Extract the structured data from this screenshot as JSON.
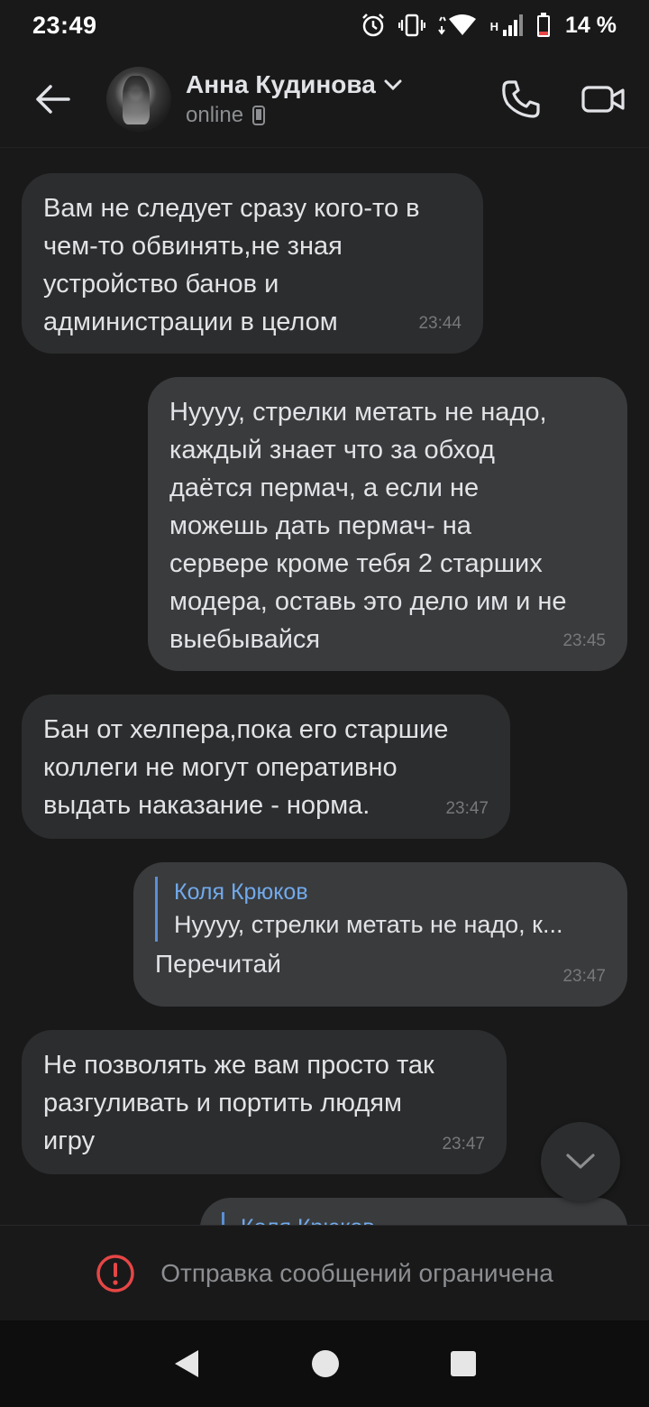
{
  "status_bar": {
    "time": "23:49",
    "network_label": "H",
    "battery": "14 %"
  },
  "header": {
    "contact_name": "Анна Кудинова",
    "contact_status": "online"
  },
  "messages": [
    {
      "direction": "in",
      "text": "Вам не следует сразу кого-то в\nчем-то обвинять,не зная\nустройство банов и\nадминистрации в целом",
      "time": "23:44"
    },
    {
      "direction": "out",
      "text": "Нуууу, стрелки метать не надо,\nкаждый знает что за обход\nдаётся пермач, а если не\nможешь дать пермач- на\nсервере кроме тебя 2 старших\nмодера, оставь это дело им и не\nвыебывайся",
      "time": "23:45"
    },
    {
      "direction": "in",
      "text": "Бан от хелпера,пока его старшие\nколлеги не могут оперативно\nвыдать наказание - норма.",
      "time": "23:47"
    },
    {
      "direction": "out",
      "reply_name": "Коля Крюков",
      "reply_text": "Нуууу, стрелки метать не надо, к...",
      "text": "Перечитай",
      "time": "23:47"
    },
    {
      "direction": "in",
      "text": "Не позволять же вам просто так\nразгуливать и портить людям\nигру",
      "time": "23:47"
    },
    {
      "direction": "out",
      "reply_name": "Коля Крюков"
    }
  ],
  "restricted_notice": "Отправка сообщений ограничена",
  "icons": {
    "back": "arrow-left",
    "call": "phone",
    "video": "video-camera",
    "scroll_down": "chevron-down",
    "alert": "exclamation-circle"
  },
  "colors": {
    "background": "#19191a",
    "bubble_in": "#2c2d2e",
    "bubble_out": "#3a3b3d",
    "reply_accent": "#71aaeb",
    "alert": "#e64646"
  }
}
